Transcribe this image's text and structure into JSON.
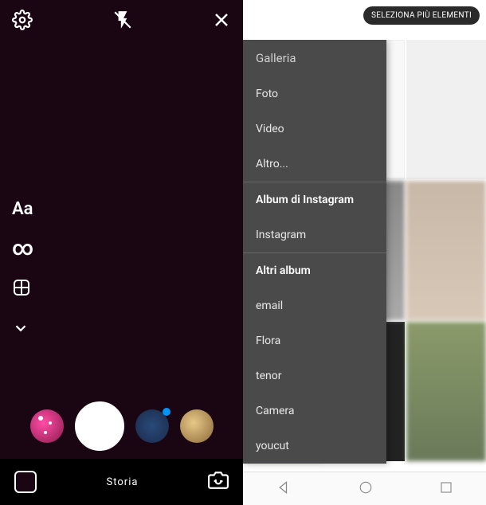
{
  "camera": {
    "tools": {
      "text": "Aa",
      "boomerang": "∞"
    },
    "footer": {
      "mode_label": "Storia"
    }
  },
  "gallery": {
    "select_button": "SELEZIONA PIÙ ELEMENTI",
    "dropdown": {
      "title": "Galleria",
      "items_main": [
        "Foto",
        "Video",
        "Altro..."
      ],
      "header_instagram": "Album di Instagram",
      "items_instagram": [
        "Instagram"
      ],
      "header_other": "Altri album",
      "items_other": [
        "email",
        "Flora",
        "tenor",
        "Camera",
        "youcut"
      ]
    }
  }
}
